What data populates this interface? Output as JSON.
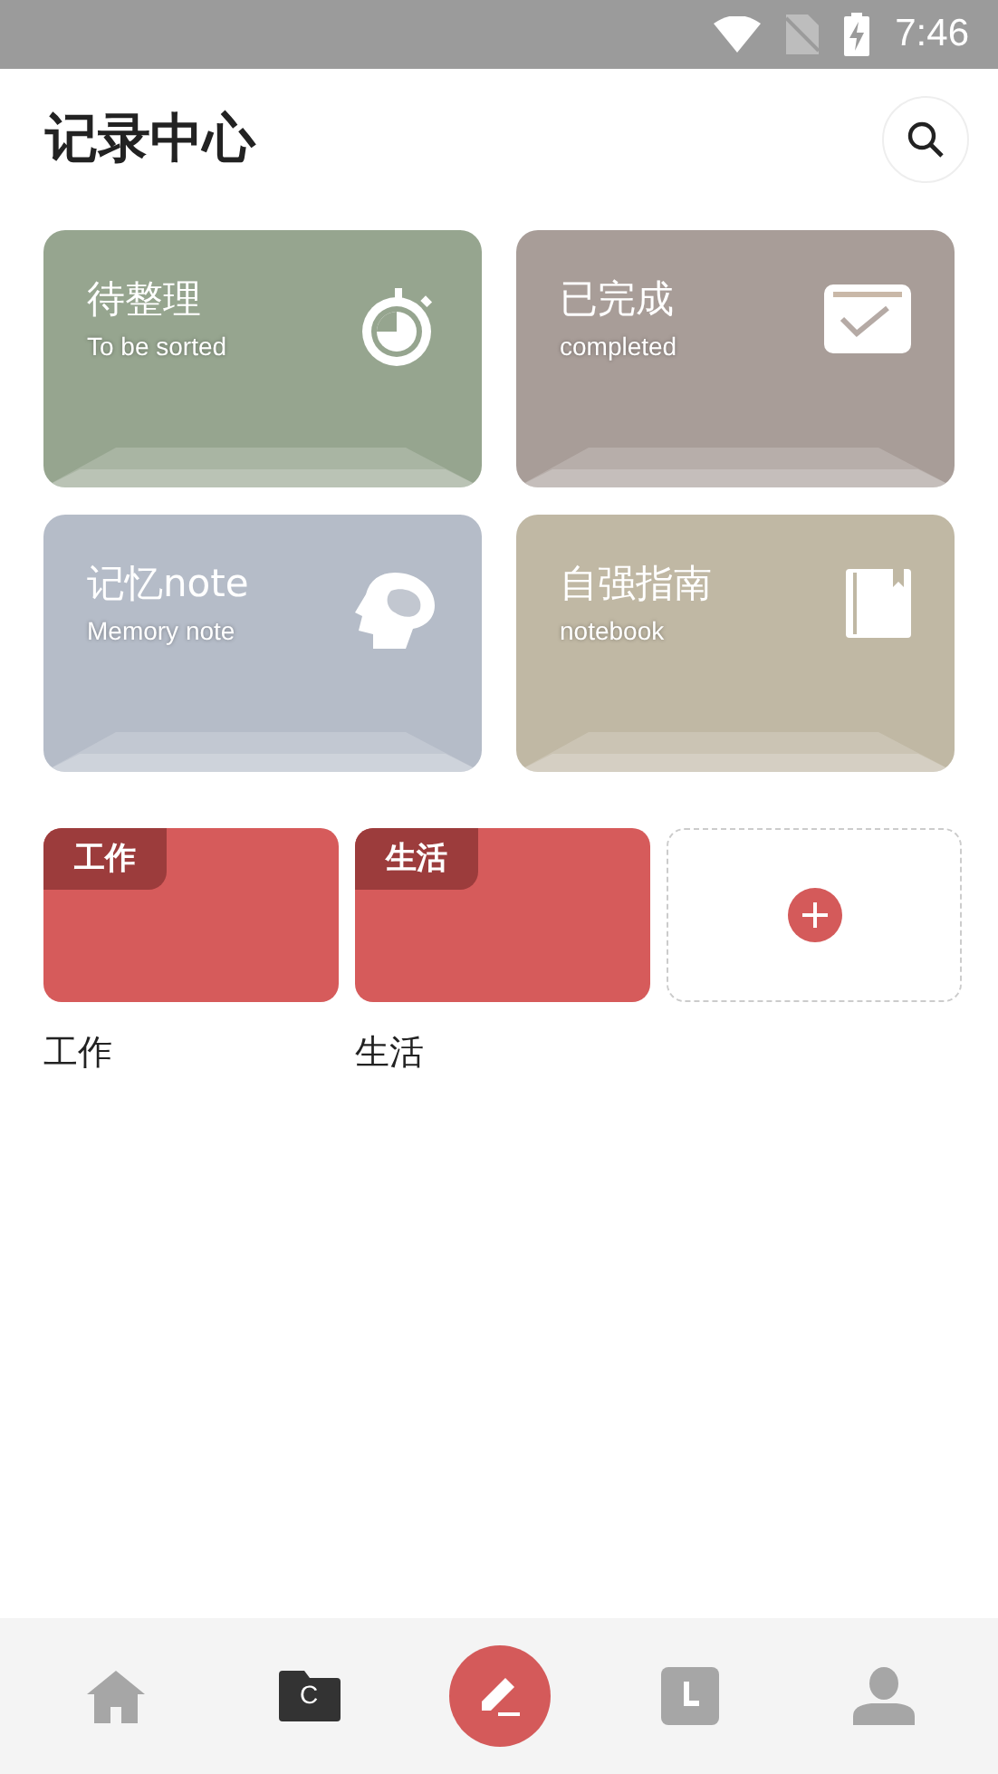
{
  "status_bar": {
    "time": "7:46"
  },
  "header": {
    "title": "记录中心"
  },
  "cards": [
    {
      "title": "待整理",
      "subtitle": "To be sorted",
      "color": "#96a58f",
      "kind": "timer"
    },
    {
      "title": "已完成",
      "subtitle": "completed",
      "color": "#a89d98",
      "kind": "calendar-check"
    },
    {
      "title": "记忆note",
      "subtitle": "Memory note",
      "color": "#b5bcc8",
      "kind": "head"
    },
    {
      "title": "自强指南",
      "subtitle": "notebook",
      "color": "#c0b8a4",
      "kind": "book"
    }
  ],
  "folders": [
    {
      "tag": "工作",
      "name": "工作"
    },
    {
      "tag": "生活",
      "name": "生活"
    }
  ],
  "bottom_nav": [
    {
      "kind": "home",
      "selected": false
    },
    {
      "kind": "folder",
      "label": "C",
      "selected": true
    },
    {
      "kind": "compose",
      "selected": false
    },
    {
      "kind": "clock",
      "selected": false
    },
    {
      "kind": "profile",
      "selected": false
    }
  ]
}
